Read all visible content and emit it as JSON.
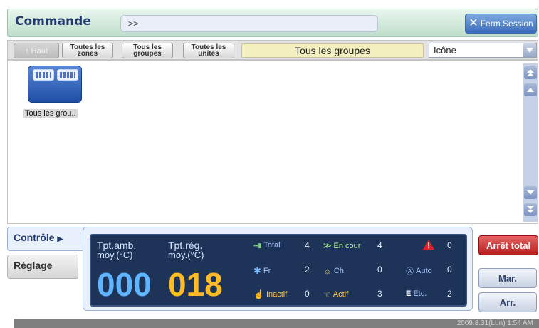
{
  "header": {
    "title": "Commande",
    "breadcrumb": ">>",
    "logout_label": "Ferm.Session"
  },
  "toolbar": {
    "up_label": "Haut",
    "all_zones": "Toutes les\nzones",
    "all_groups": "Tous les\ngroupes",
    "all_units": "Toutes les\nunités",
    "current_group": "Tous les groupes",
    "view_mode": "Icône"
  },
  "content": {
    "tile_label": "Tous les grou.."
  },
  "tabs": {
    "control": "Contrôle",
    "settings": "Réglage"
  },
  "panel": {
    "amb_label_1": "Tpt.amb.",
    "amb_label_2": "moy.(°C)",
    "set_label_1": "Tpt.rég.",
    "set_label_2": "moy.(°C)",
    "amb_value": "000",
    "set_value": "018",
    "stats": {
      "total_label": "Total",
      "total_value": "4",
      "running_label": "En cour",
      "running_value": "4",
      "alarm_value": "0",
      "cool_label": "Fr",
      "cool_value": "2",
      "heat_label": "Ch",
      "heat_value": "0",
      "auto_label": "Auto",
      "auto_value": "0",
      "inactive_label": "Inactif",
      "inactive_value": "0",
      "active_label": "Actif",
      "active_value": "3",
      "etc_prefix": "E",
      "etc_label": "Etc.",
      "etc_value": "2"
    }
  },
  "actions": {
    "stop_all": "Arrêt total",
    "on": "Mar.",
    "off": "Arr."
  },
  "status": {
    "datetime": "2009.8.31(Lun)  1:54 AM"
  },
  "colors": {
    "accent": "#3a6db8",
    "alarm": "#e02222",
    "panel_bg": "#1d3358",
    "ambient": "#5fb4ff",
    "setpoint": "#ffbb22"
  }
}
